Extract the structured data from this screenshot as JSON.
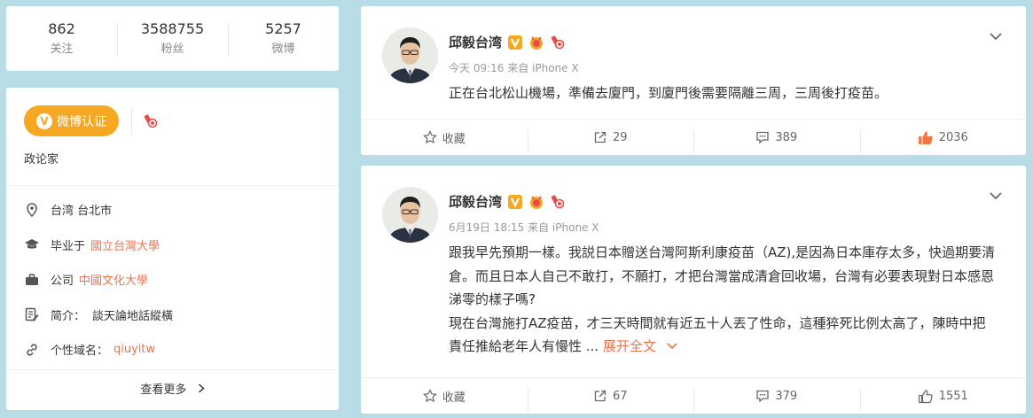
{
  "stats": [
    {
      "value": "862",
      "label": "关注"
    },
    {
      "value": "3588755",
      "label": "粉丝"
    },
    {
      "value": "5257",
      "label": "微博"
    }
  ],
  "profile": {
    "verify_label": "微博认证",
    "verify_desc": "政论家",
    "location": "台湾 台北市",
    "education_label": "毕业于",
    "education_value": "國立台灣大學",
    "company_label": "公司",
    "company_value": "中國文化大學",
    "bio_label": "简介：",
    "bio_value": "談天論地話縱橫",
    "domain_label": "个性域名：",
    "domain_value": "qiuyitw",
    "more_label": "查看更多"
  },
  "posts": [
    {
      "author": "邱毅台湾",
      "meta": "今天 09:16 来自 iPhone X",
      "text": "正在台北松山機場，準備去廈門，到廈門後需要隔離三周，三周後打疫苗。",
      "actions": {
        "favorite": "收藏",
        "repost": "29",
        "comment": "389",
        "like": "2036"
      }
    },
    {
      "author": "邱毅台湾",
      "meta": "6月19日 18:15 来自 iPhone X",
      "text": "跟我早先預期一樣。我説日本贈送台灣阿斯利康疫苗（AZ),是因為日本庫存太多，快過期要清倉。而且日本人自己不敢打，不願打，才把台灣當成清倉回收場，台灣有必要表現對日本感恩涕零的樣子嗎?\n現在台灣施打AZ疫苗，才三天時間就有近五十人丟了性命，這種猝死比例太高了，陳時中把責任推給老年人有慢性 ...",
      "expand_label": "展开全文",
      "actions": {
        "favorite": "收藏",
        "repost": "67",
        "comment": "379",
        "like": "1551"
      }
    }
  ],
  "colors": {
    "accent": "#eb7350",
    "verify": "#f7a822",
    "background": "#b9dde6"
  }
}
